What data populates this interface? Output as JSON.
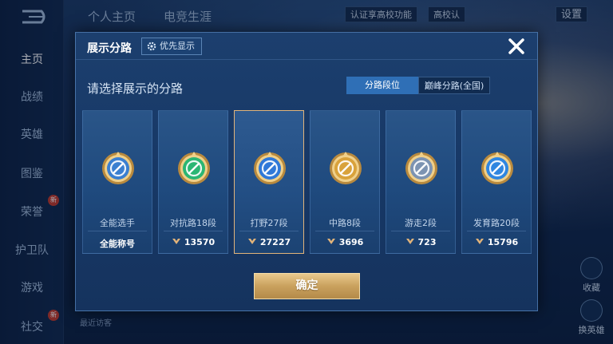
{
  "background": {
    "top_tabs": [
      "个人主页",
      "电竞生涯"
    ],
    "top_right": {
      "campus_auth": "认证享高校功能",
      "campus_tag": "高校认",
      "settings": "设置"
    },
    "sidebar": {
      "items": [
        {
          "label": "主页",
          "active": true
        },
        {
          "label": "战绩"
        },
        {
          "label": "英雄"
        },
        {
          "label": "图鉴"
        },
        {
          "label": "荣誉",
          "badge": "新"
        },
        {
          "label": "护卫队"
        },
        {
          "label": "游戏"
        },
        {
          "label": "社交",
          "badge": "新"
        }
      ]
    },
    "recent_visitors": "最近访客",
    "side_buttons": [
      "收藏",
      "换英雄"
    ]
  },
  "modal": {
    "title": "展示分路",
    "priority_button": "优先显示",
    "priority_icon": "gear-icon",
    "close_icon": "close-icon",
    "subtitle": "请选择展示的分路",
    "segments": [
      {
        "label": "分路段位",
        "selected": true
      },
      {
        "label": "巅峰分路(全国)",
        "selected": false
      }
    ],
    "cards": [
      {
        "role": "全能选手",
        "score": "全能称号",
        "show_score_icon": false,
        "badge_color": "#3b7fd0",
        "selected": false
      },
      {
        "role": "对抗路18段",
        "score": "13570",
        "show_score_icon": true,
        "badge_color": "#2bb673",
        "selected": false
      },
      {
        "role": "打野27段",
        "score": "27227",
        "show_score_icon": true,
        "badge_color": "#2f78d8",
        "selected": true
      },
      {
        "role": "中路8段",
        "score": "3696",
        "show_score_icon": true,
        "badge_color": "#d9a23b",
        "selected": false
      },
      {
        "role": "游走2段",
        "score": "723",
        "show_score_icon": true,
        "badge_color": "#7c93b2",
        "selected": false
      },
      {
        "role": "发育路20段",
        "score": "15796",
        "show_score_icon": true,
        "badge_color": "#2f86e0",
        "selected": false
      }
    ],
    "confirm_button": "确定"
  },
  "colors": {
    "accent_gold": "#e2b47a",
    "segment_active": "#2f6fb6",
    "panel": "#1c3f6e"
  }
}
